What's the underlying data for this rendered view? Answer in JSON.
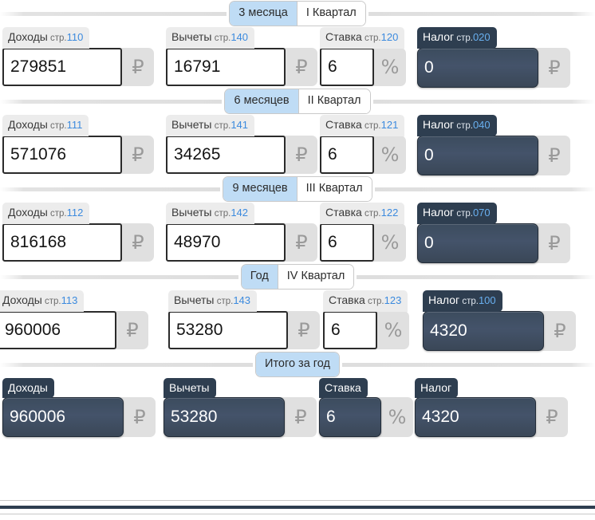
{
  "currency_symbol": "₽",
  "percent_symbol": "%",
  "colors": {
    "accent_blue": "#3b8ade",
    "tab_active": "#bfdcf5",
    "dark_field": "#3c4c5e",
    "tag_light": "#ececec"
  },
  "sections": [
    {
      "id": "q1",
      "tabs": [
        {
          "label": "3 месяца",
          "active": true
        },
        {
          "label": "I Квартал",
          "active": false
        }
      ],
      "fields": {
        "income": {
          "label": "Доходы",
          "page_prefix": "стр.",
          "page": "110",
          "value": "279851",
          "suffix": "₽",
          "dark": false
        },
        "deduction": {
          "label": "Вычеты",
          "page_prefix": "стр.",
          "page": "140",
          "value": "16791",
          "suffix": "₽",
          "dark": false
        },
        "rate": {
          "label": "Ставка",
          "page_prefix": "стр.",
          "page": "120",
          "value": "6",
          "suffix": "%",
          "dark": false
        },
        "tax": {
          "label": "Налог",
          "page_prefix": "стр.",
          "page": "020",
          "value": "0",
          "suffix": "₽",
          "dark": true
        }
      }
    },
    {
      "id": "q2",
      "tabs": [
        {
          "label": "6 месяцев",
          "active": true
        },
        {
          "label": "II Квартал",
          "active": false
        }
      ],
      "fields": {
        "income": {
          "label": "Доходы",
          "page_prefix": "стр.",
          "page": "111",
          "value": "571076",
          "suffix": "₽",
          "dark": false
        },
        "deduction": {
          "label": "Вычеты",
          "page_prefix": "стр.",
          "page": "141",
          "value": "34265",
          "suffix": "₽",
          "dark": false
        },
        "rate": {
          "label": "Ставка",
          "page_prefix": "стр.",
          "page": "121",
          "value": "6",
          "suffix": "%",
          "dark": false
        },
        "tax": {
          "label": "Налог",
          "page_prefix": "стр.",
          "page": "040",
          "value": "0",
          "suffix": "₽",
          "dark": true
        }
      }
    },
    {
      "id": "q3",
      "tabs": [
        {
          "label": "9 месяцев",
          "active": true
        },
        {
          "label": "III Квартал",
          "active": false
        }
      ],
      "fields": {
        "income": {
          "label": "Доходы",
          "page_prefix": "стр.",
          "page": "112",
          "value": "816168",
          "suffix": "₽",
          "dark": false
        },
        "deduction": {
          "label": "Вычеты",
          "page_prefix": "стр.",
          "page": "142",
          "value": "48970",
          "suffix": "₽",
          "dark": false
        },
        "rate": {
          "label": "Ставка",
          "page_prefix": "стр.",
          "page": "122",
          "value": "6",
          "suffix": "%",
          "dark": false
        },
        "tax": {
          "label": "Налог",
          "page_prefix": "стр.",
          "page": "070",
          "value": "0",
          "suffix": "₽",
          "dark": true
        }
      }
    },
    {
      "id": "q4",
      "tabs": [
        {
          "label": "Год",
          "active": true
        },
        {
          "label": "IV Квартал",
          "active": false
        }
      ],
      "fields": {
        "income": {
          "label": "Доходы",
          "page_prefix": "стр.",
          "page": "113",
          "value": "960006",
          "suffix": "₽",
          "dark": false
        },
        "deduction": {
          "label": "Вычеты",
          "page_prefix": "стр.",
          "page": "143",
          "value": "53280",
          "suffix": "₽",
          "dark": false
        },
        "rate": {
          "label": "Ставка",
          "page_prefix": "стр.",
          "page": "123",
          "value": "6",
          "suffix": "%",
          "dark": false
        },
        "tax": {
          "label": "Налог",
          "page_prefix": "стр.",
          "page": "100",
          "value": "4320",
          "suffix": "₽",
          "dark": true
        }
      }
    },
    {
      "id": "total",
      "tabs": [
        {
          "label": "Итого за год",
          "active": true
        }
      ],
      "fields": {
        "income": {
          "label": "Доходы",
          "page_prefix": "",
          "page": "",
          "value": "960006",
          "suffix": "₽",
          "dark": true
        },
        "deduction": {
          "label": "Вычеты",
          "page_prefix": "",
          "page": "",
          "value": "53280",
          "suffix": "₽",
          "dark": true
        },
        "rate": {
          "label": "Ставка",
          "page_prefix": "",
          "page": "",
          "value": "6",
          "suffix": "%",
          "dark": true
        },
        "tax": {
          "label": "Налог",
          "page_prefix": "",
          "page": "",
          "value": "4320",
          "suffix": "₽",
          "dark": true
        }
      }
    }
  ]
}
